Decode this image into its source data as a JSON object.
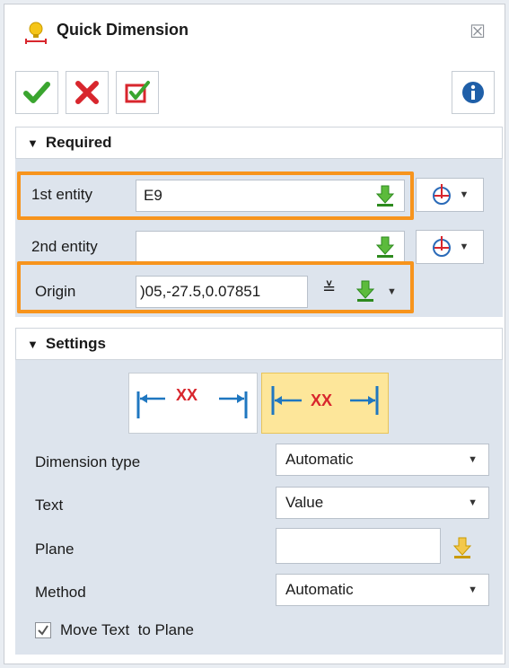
{
  "title": "Quick Dimension",
  "toolbar": {
    "ok_icon": "checkmark-icon",
    "cancel_icon": "x-icon",
    "apply_icon": "apply-checkbox-icon",
    "info_icon": "info-icon",
    "close_glyph": "☒"
  },
  "required": {
    "header": "Required",
    "first_entity_label": "1st entity",
    "first_entity_value": "E9",
    "second_entity_label": "2nd entity",
    "second_entity_value": "",
    "origin_label": "Origin",
    "origin_value": ")05,-27.5,0.07851"
  },
  "settings": {
    "header": "Settings",
    "style_text": "XX",
    "dimension_type_label": "Dimension type",
    "dimension_type_value": "Automatic",
    "text_label": "Text",
    "text_value": "Value",
    "plane_label": "Plane",
    "plane_value": "",
    "method_label": "Method",
    "method_value": "Automatic",
    "move_text_label": "Move Text  to Plane",
    "move_text_checked": true
  },
  "colors": {
    "highlight": "#f7941d",
    "accent_green": "#3aa52f",
    "accent_red": "#d8262d",
    "selected_bg": "#fde69a"
  }
}
